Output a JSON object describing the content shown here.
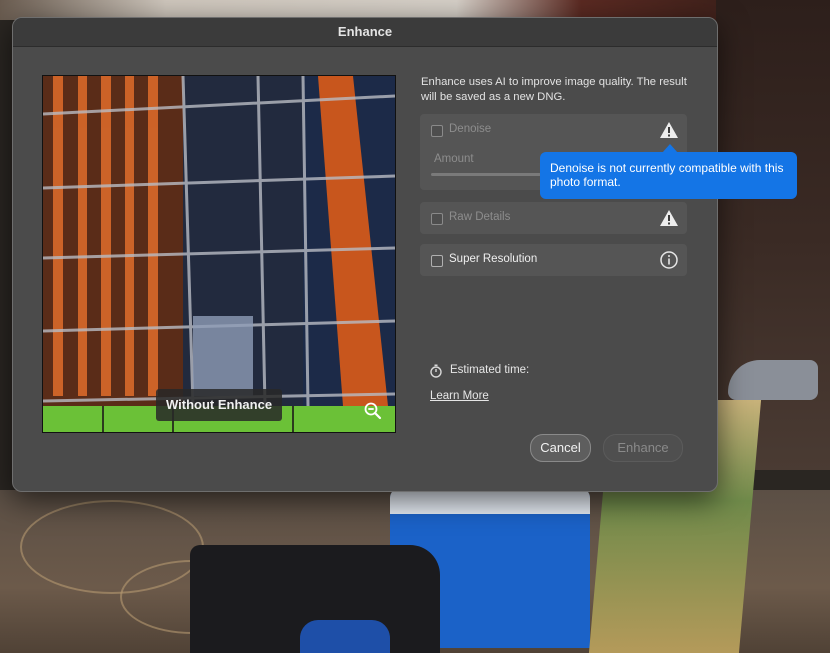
{
  "dialog": {
    "title": "Enhance",
    "description": "Enhance uses AI to improve image quality. The result will be saved as a new DNG.",
    "preview_label": "Without Enhance",
    "options": {
      "denoise": {
        "label": "Denoise",
        "checked": false,
        "enabled": false,
        "amount_label": "Amount"
      },
      "raw_details": {
        "label": "Raw Details",
        "checked": false,
        "enabled": false
      },
      "super_resolution": {
        "label": "Super Resolution",
        "checked": false,
        "enabled": true
      }
    },
    "tooltip": "Denoise is not currently compatible with this photo format.",
    "estimated_time_label": "Estimated time:",
    "learn_more": "Learn More",
    "buttons": {
      "cancel": "Cancel",
      "enhance": "Enhance"
    }
  },
  "icons": {
    "warning": "warning-triangle-icon",
    "info": "info-circle-icon",
    "zoom": "zoom-out-icon",
    "timer": "stopwatch-icon"
  },
  "colors": {
    "tooltip_bg": "#1475e6",
    "dialog_bg": "#4b4b4b"
  }
}
